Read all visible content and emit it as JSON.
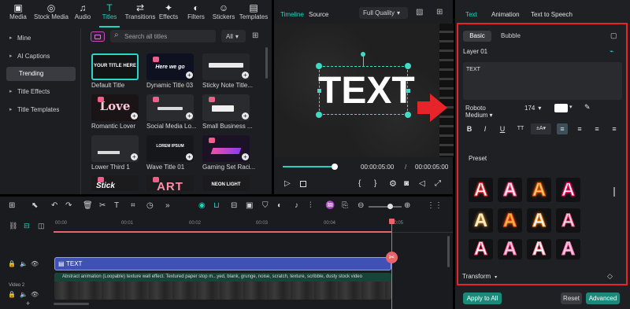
{
  "toolbar": {
    "items": [
      {
        "label": "Media",
        "icon": "media-icon"
      },
      {
        "label": "Stock Media",
        "icon": "stock-media-icon"
      },
      {
        "label": "Audio",
        "icon": "audio-icon"
      },
      {
        "label": "Titles",
        "icon": "titles-icon"
      },
      {
        "label": "Transitions",
        "icon": "transitions-icon"
      },
      {
        "label": "Effects",
        "icon": "effects-icon"
      },
      {
        "label": "Filters",
        "icon": "filters-icon"
      },
      {
        "label": "Stickers",
        "icon": "stickers-icon"
      },
      {
        "label": "Templates",
        "icon": "templates-icon"
      }
    ]
  },
  "sidebar": {
    "items": [
      {
        "label": "Mine"
      },
      {
        "label": "AI Captions"
      },
      {
        "label": "Trending"
      },
      {
        "label": "Title Effects"
      },
      {
        "label": "Title Templates"
      }
    ]
  },
  "search": {
    "placeholder": "Search all titles",
    "filter": "All"
  },
  "titles": [
    {
      "label": "Default Title",
      "thumb_text": "YOUR TITLE HERE"
    },
    {
      "label": "Dynamic Title 03",
      "thumb_text": "Here we go"
    },
    {
      "label": "Sticky Note Title..."
    },
    {
      "label": "Romantic Lover",
      "thumb_text": "Love"
    },
    {
      "label": "Social Media Lo..."
    },
    {
      "label": "Small Business ..."
    },
    {
      "label": "Lower Third 1"
    },
    {
      "label": "Wave Title 01",
      "thumb_text": "LOREM IPSUM"
    },
    {
      "label": "Gaming Set Raci..."
    },
    {
      "thumb_text": "Stick"
    },
    {
      "thumb_text": "ART"
    },
    {
      "thumb_text": "NEON LIGHT"
    }
  ],
  "player": {
    "tab_timeline": "Timeline",
    "tab_source": "Source",
    "quality": "Full Quality",
    "preview_text": "TEXT",
    "current_time": "00:00:05:00",
    "separator": "/",
    "total_time": "00:00:05:00",
    "progress": 0.97
  },
  "timeline": {
    "ruler": [
      "00:00",
      "00:01",
      "00:02",
      "00:03",
      "00:04",
      "00:05"
    ],
    "text_clip": "TEXT",
    "video_clip": "Abstract animation (Loopable) texture wall effect. Textured paper stop m...yed, blank, grunge, noise, scratch, texture, scribble, dusty stock video",
    "track_label": "Video 2"
  },
  "right": {
    "tabs": [
      "Text",
      "Animation",
      "Text to Speech"
    ],
    "subtabs": [
      "Basic",
      "Bubble"
    ],
    "layer": "Layer 01",
    "text_value": "TEXT",
    "font": "Roboto Medium",
    "size": "174",
    "preset_label": "Preset",
    "transform_label": "Transform",
    "apply_all": "Apply to All",
    "reset": "Reset",
    "advanced": "Advanced",
    "text_color": "#ffffff",
    "highlight_color": "#e8242b"
  }
}
